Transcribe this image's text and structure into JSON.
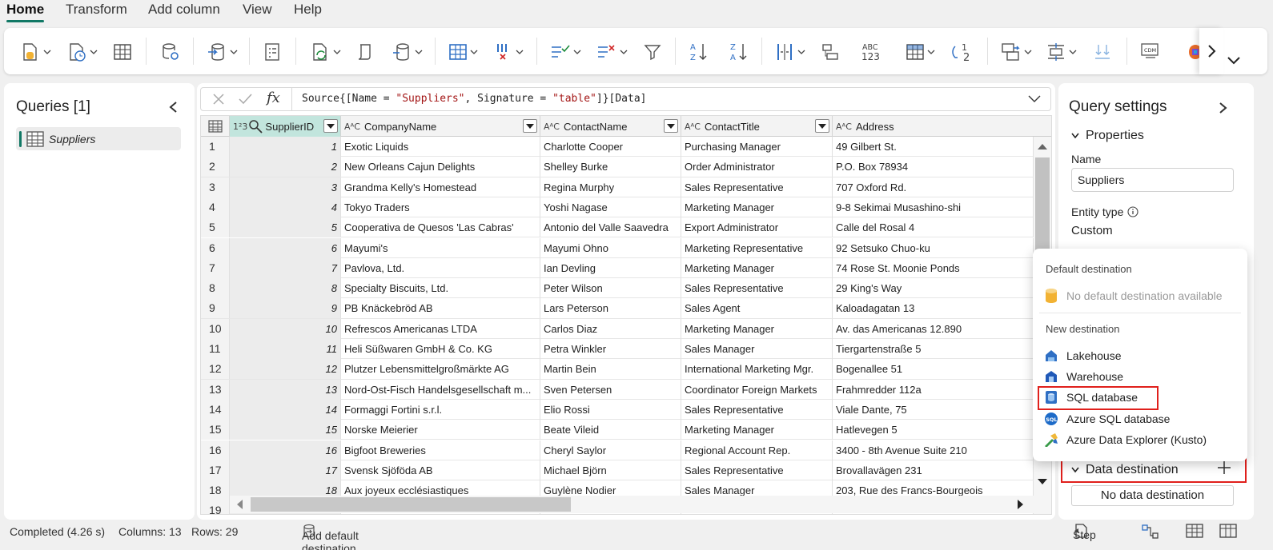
{
  "menu": {
    "tabs": [
      {
        "label": "Home",
        "active": true
      },
      {
        "label": "Transform",
        "active": false
      },
      {
        "label": "Add column",
        "active": false
      },
      {
        "label": "View",
        "active": false
      },
      {
        "label": "Help",
        "active": false
      }
    ]
  },
  "queries": {
    "title": "Queries [1]",
    "items": [
      {
        "label": "Suppliers"
      }
    ]
  },
  "formula": {
    "code_prefix": "Source{[Name = ",
    "str1": "\"Suppliers\"",
    "code_mid": ", Signature = ",
    "str2": "\"table\"",
    "code_suffix": "]}[Data]"
  },
  "grid": {
    "columns": [
      {
        "type": "1²3",
        "name": "SupplierID"
      },
      {
        "type": "AᴬC",
        "name": "CompanyName"
      },
      {
        "type": "AᴬC",
        "name": "ContactName"
      },
      {
        "type": "AᴬC",
        "name": "ContactTitle"
      },
      {
        "type": "AᴬC",
        "name": "Address"
      }
    ],
    "rows": [
      [
        "1",
        "1",
        "Exotic Liquids",
        "Charlotte Cooper",
        "Purchasing Manager",
        "49 Gilbert St."
      ],
      [
        "2",
        "2",
        "New Orleans Cajun Delights",
        "Shelley Burke",
        "Order Administrator",
        "P.O. Box 78934"
      ],
      [
        "3",
        "3",
        "Grandma Kelly's Homestead",
        "Regina Murphy",
        "Sales Representative",
        "707 Oxford Rd."
      ],
      [
        "4",
        "4",
        "Tokyo Traders",
        "Yoshi Nagase",
        "Marketing Manager",
        "9-8 Sekimai Musashino-shi"
      ],
      [
        "5",
        "5",
        "Cooperativa de Quesos 'Las Cabras'",
        "Antonio del Valle Saavedra",
        "Export Administrator",
        "Calle del Rosal 4"
      ],
      [
        "6",
        "6",
        "Mayumi's",
        "Mayumi Ohno",
        "Marketing Representative",
        "92 Setsuko Chuo-ku"
      ],
      [
        "7",
        "7",
        "Pavlova, Ltd.",
        "Ian Devling",
        "Marketing Manager",
        "74 Rose St. Moonie Ponds"
      ],
      [
        "8",
        "8",
        "Specialty Biscuits, Ltd.",
        "Peter Wilson",
        "Sales Representative",
        "29 King's Way"
      ],
      [
        "9",
        "9",
        "PB Knäckebröd AB",
        "Lars Peterson",
        "Sales Agent",
        "Kaloadagatan 13"
      ],
      [
        "10",
        "10",
        "Refrescos Americanas LTDA",
        "Carlos Diaz",
        "Marketing Manager",
        "Av. das Americanas 12.890"
      ],
      [
        "11",
        "11",
        "Heli Süßwaren GmbH & Co. KG",
        "Petra Winkler",
        "Sales Manager",
        "Tiergartenstraße 5"
      ],
      [
        "12",
        "12",
        "Plutzer Lebensmittelgroßmärkte AG",
        "Martin Bein",
        "International Marketing Mgr.",
        "Bogenallee 51"
      ],
      [
        "13",
        "13",
        "Nord-Ost-Fisch Handelsgesellschaft m...",
        "Sven Petersen",
        "Coordinator Foreign Markets",
        "Frahmredder 112a"
      ],
      [
        "14",
        "14",
        "Formaggi Fortini s.r.l.",
        "Elio Rossi",
        "Sales Representative",
        "Viale Dante, 75"
      ],
      [
        "15",
        "15",
        "Norske Meierier",
        "Beate Vileid",
        "Marketing Manager",
        "Hatlevegen 5"
      ],
      [
        "16",
        "16",
        "Bigfoot Breweries",
        "Cheryl Saylor",
        "Regional Account Rep.",
        "3400 - 8th Avenue Suite 210"
      ],
      [
        "17",
        "17",
        "Svensk Sjöföda AB",
        "Michael Björn",
        "Sales Representative",
        "Brovallavägen 231"
      ],
      [
        "18",
        "18",
        "Aux joyeux ecclésiastiques",
        "Guylène Nodier",
        "Sales Manager",
        "203, Rue des Francs-Bourgeois"
      ],
      [
        "19",
        "",
        "",
        "",
        "",
        ""
      ]
    ]
  },
  "settings": {
    "title": "Query settings",
    "properties_label": "Properties",
    "name_label": "Name",
    "name_value": "Suppliers",
    "entity_type_label": "Entity type",
    "entity_type_value": "Custom",
    "data_destination_label": "Data destination",
    "no_data_destination": "No data destination"
  },
  "popup": {
    "default_header": "Default destination",
    "no_default": "No default destination available",
    "new_header": "New destination",
    "options": [
      {
        "label": "Lakehouse",
        "icon": "lakehouse-icon"
      },
      {
        "label": "Warehouse",
        "icon": "warehouse-icon"
      },
      {
        "label": "SQL database",
        "icon": "sql-database-icon"
      },
      {
        "label": "Azure SQL database",
        "icon": "azure-sql-icon"
      },
      {
        "label": "Azure Data Explorer (Kusto)",
        "icon": "kusto-icon"
      }
    ]
  },
  "status": {
    "completed": "Completed (4.26 s)",
    "columns": "Columns: 13",
    "rows": "Rows: 29",
    "add_default": "Add default destination...",
    "step": "Step"
  },
  "colors": {
    "accent": "#117865",
    "highlight": "#e0201c",
    "selected_header": "#c2e5dd"
  }
}
